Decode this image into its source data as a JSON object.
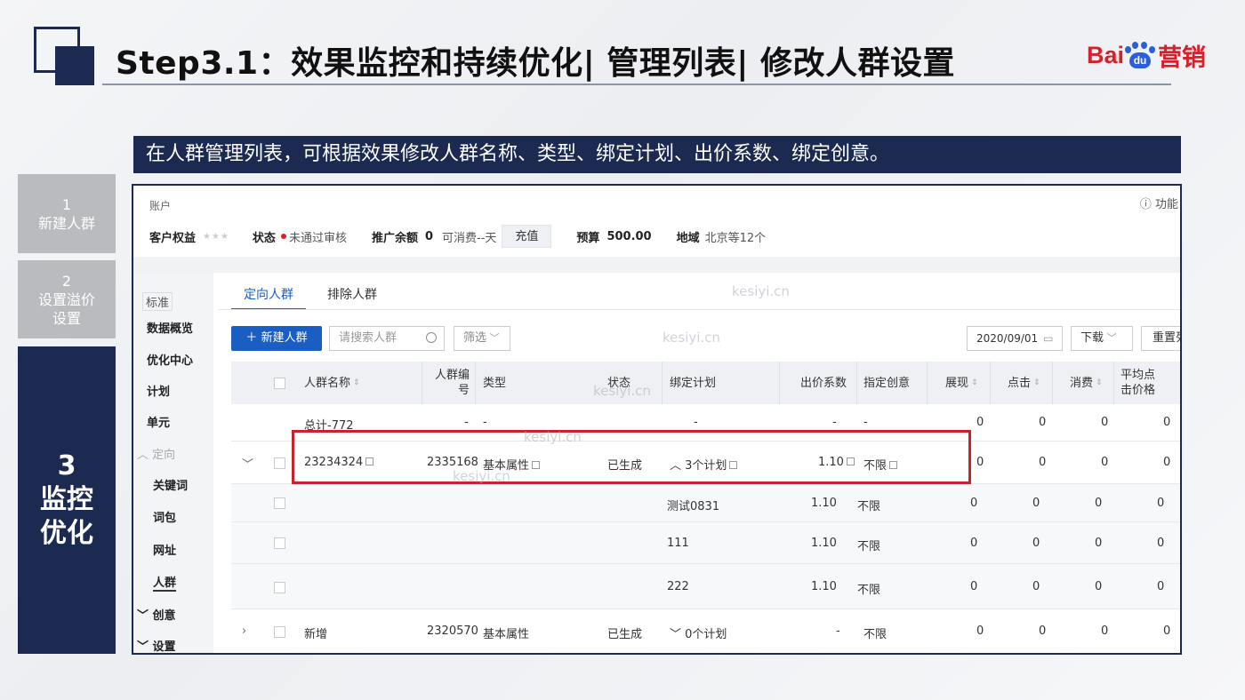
{
  "slide": {
    "title": "Step3.1：效果监控和持续优化| 管理列表| 修改人群设置",
    "brand_red": "#d7202a",
    "brand_blue": "#2b5fd9",
    "navy": "#1c2a52",
    "logo": {
      "bai": "Bai",
      "du": "du",
      "suffix": "营销"
    },
    "banner": "在人群管理列表，可根据效果修改人群名称、类型、绑定计划、出价系数、绑定创意。"
  },
  "steps": [
    {
      "num": "1",
      "label": "新建人群",
      "active": false
    },
    {
      "num": "2",
      "label_line1": "设置溢价",
      "label_line2": "设置",
      "active": false
    },
    {
      "num": "3",
      "label_line1": "监控",
      "label_line2": "优化",
      "active": true
    }
  ],
  "screen": {
    "account_label": "账户",
    "func_link": "ⓘ 功能",
    "info": {
      "customer_rights": "客户权益",
      "stars": "★★★",
      "status_label": "状态",
      "status_value": "未通过审核",
      "balance_label": "推广余额",
      "balance_value": "0",
      "consumable": "可消费--天",
      "recharge": "充值",
      "budget_label": "预算",
      "budget_value": "500.00",
      "region_label": "地域",
      "region_value": "北京等12个"
    },
    "nav": {
      "standard": "标准",
      "items": [
        "数据概览",
        "优化中心",
        "计划",
        "单元"
      ],
      "targeting": "定向",
      "sub_items": [
        "关键词",
        "词包",
        "网址",
        "人群"
      ],
      "creative": "创意",
      "settings": "设置"
    },
    "tabs": [
      "定向人群",
      "排除人群"
    ],
    "toolbar": {
      "new_button": "新建人群",
      "search_placeholder": "请搜索人群",
      "filter": "筛选",
      "date": "2020/09/01",
      "download": "下载",
      "reset": "重置列"
    },
    "columns": {
      "name": "人群名称",
      "id_line1": "人群编",
      "id_line2": "号",
      "type": "类型",
      "status": "状态",
      "plans": "绑定计划",
      "bid": "出价系数",
      "creative": "指定创意",
      "impressions": "展现",
      "clicks": "点击",
      "spend": "消费",
      "avg_line1": "平均点",
      "avg_line2": "击价格"
    },
    "rows": {
      "total": {
        "name": "总计-772",
        "id": "-",
        "type": "-",
        "plans": "-",
        "bid": "-",
        "creative": "-",
        "impressions": "0",
        "clicks": "0",
        "spend": "0",
        "avg": "0"
      },
      "main": {
        "name": "23234324",
        "id": "2335168",
        "type": "基本属性",
        "status": "已生成",
        "plans": "3个计划",
        "bid": "1.10",
        "creative": "不限",
        "impressions": "0",
        "clicks": "0",
        "spend": "0",
        "avg": "0"
      },
      "subs": [
        {
          "plan": "测试0831",
          "bid": "1.10",
          "creative": "不限",
          "impressions": "0",
          "clicks": "0",
          "spend": "0",
          "avg": "0"
        },
        {
          "plan": "111",
          "bid": "1.10",
          "creative": "不限",
          "impressions": "0",
          "clicks": "0",
          "spend": "0",
          "avg": "0"
        },
        {
          "plan": "222",
          "bid": "1.10",
          "creative": "不限",
          "impressions": "0",
          "clicks": "0",
          "spend": "0",
          "avg": "0"
        }
      ],
      "new": {
        "name": "新增",
        "id": "2320570",
        "type": "基本属性",
        "status": "已生成",
        "plans": "0个计划",
        "bid": "-",
        "creative": "不限",
        "impressions": "0",
        "clicks": "0",
        "spend": "0",
        "avg": "0"
      }
    },
    "watermark": "kesiyi.cn"
  }
}
